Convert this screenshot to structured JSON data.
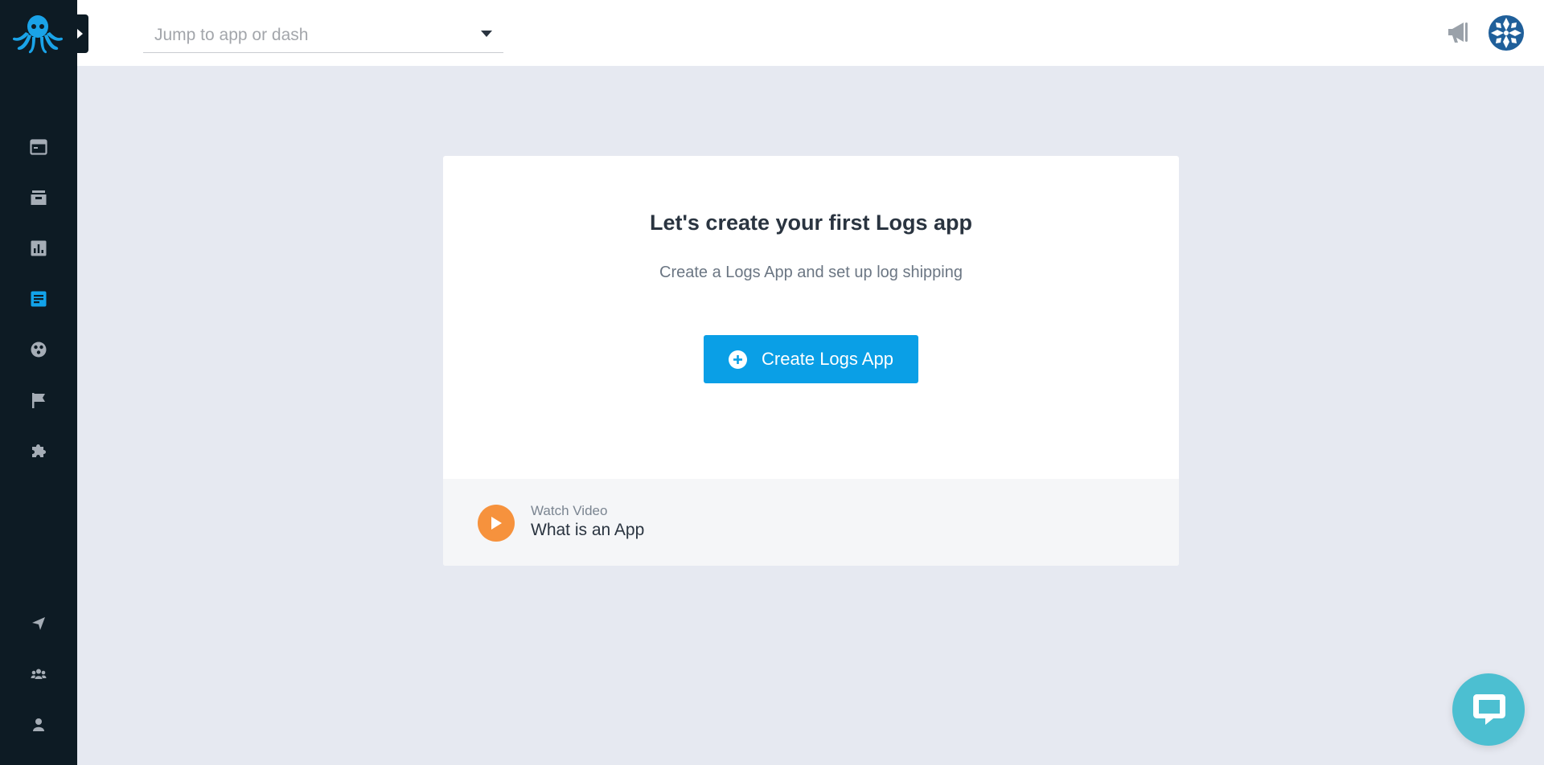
{
  "topbar": {
    "jump_placeholder": "Jump to app or dash"
  },
  "sidebar": {
    "items": [
      {
        "name": "sidebar-item-dashboards",
        "icon": "window-icon"
      },
      {
        "name": "sidebar-item-archive",
        "icon": "inbox-icon"
      },
      {
        "name": "sidebar-item-metrics",
        "icon": "bar-chart-icon"
      },
      {
        "name": "sidebar-item-logs",
        "icon": "document-icon",
        "active": true
      },
      {
        "name": "sidebar-item-monitoring",
        "icon": "radar-icon"
      },
      {
        "name": "sidebar-item-flags",
        "icon": "flag-icon"
      },
      {
        "name": "sidebar-item-integrations",
        "icon": "puzzle-icon"
      },
      {
        "name": "sidebar-item-feedback",
        "icon": "send-icon"
      },
      {
        "name": "sidebar-item-team",
        "icon": "team-icon"
      },
      {
        "name": "sidebar-item-profile",
        "icon": "user-icon"
      }
    ]
  },
  "card": {
    "title": "Let's create your first Logs app",
    "subtitle": "Create a Logs App and set up log shipping",
    "create_button_label": "Create Logs App",
    "watch_label": "Watch Video",
    "watch_title": "What is an App"
  },
  "colors": {
    "sidebar_bg": "#0d1b24",
    "accent": "#0a9fe6",
    "active_icon": "#12a3ea",
    "icon": "#a5adb6",
    "play_orange": "#f6923d",
    "chat": "#4cbfd1"
  }
}
